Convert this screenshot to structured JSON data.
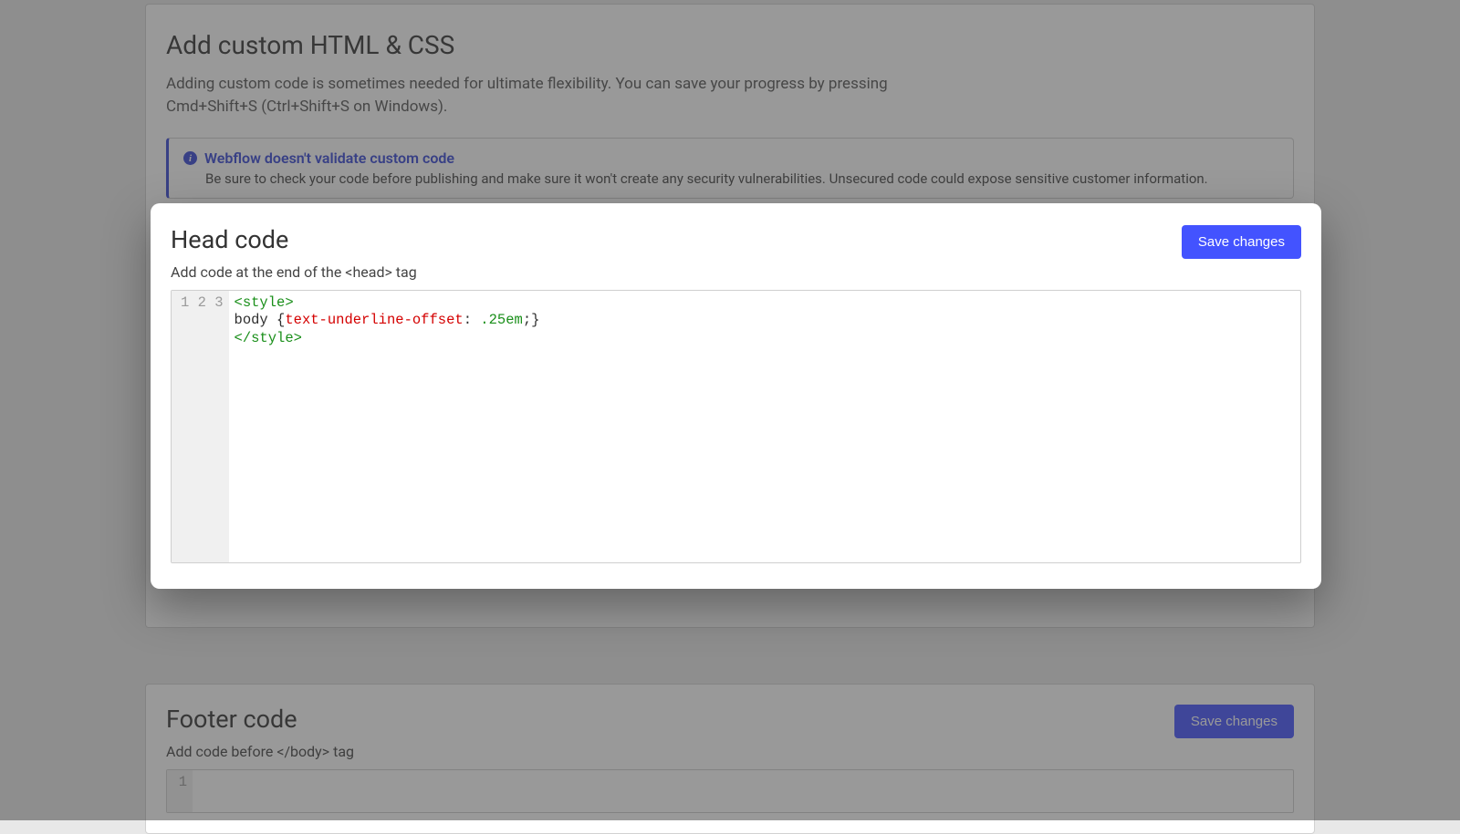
{
  "page": {
    "title": "Add custom HTML & CSS",
    "description": "Adding custom code is sometimes needed for ultimate flexibility. You can save your progress by pressing Cmd+Shift+S (Ctrl+Shift+S on Windows)."
  },
  "alert": {
    "title": "Webflow doesn't validate custom code",
    "body": "Be sure to check your code before publishing and make sure it won't create any security vulnerabilities. Unsecured code could expose sensitive customer information."
  },
  "head_section": {
    "title": "Head code",
    "subtitle": "Add code at the end of the <head> tag",
    "save_label": "Save changes",
    "code_lines": [
      {
        "n": "1",
        "tokens": [
          {
            "t": "<style>",
            "c": "tok-tag"
          }
        ]
      },
      {
        "n": "2",
        "tokens": [
          {
            "t": "body ",
            "c": "tok-sel"
          },
          {
            "t": "{",
            "c": "tok-punc"
          },
          {
            "t": "text-underline-offset",
            "c": "tok-prop"
          },
          {
            "t": ": ",
            "c": "tok-punc"
          },
          {
            "t": ".25em",
            "c": "tok-val"
          },
          {
            "t": ";}",
            "c": "tok-punc"
          }
        ]
      },
      {
        "n": "3",
        "tokens": [
          {
            "t": "</style>",
            "c": "tok-tag"
          }
        ]
      }
    ]
  },
  "footer_section": {
    "title": "Footer code",
    "subtitle": "Add code before </body> tag",
    "save_label": "Save changes",
    "code_lines": [
      {
        "n": "1",
        "tokens": []
      }
    ]
  }
}
